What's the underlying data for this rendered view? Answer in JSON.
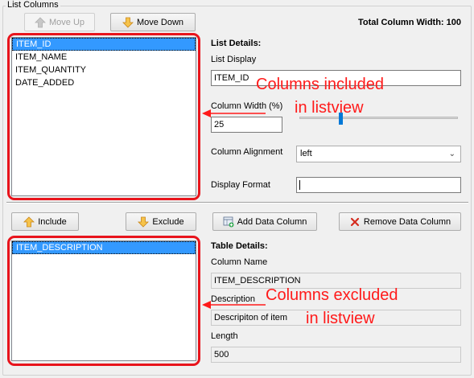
{
  "group": {
    "title": "List Columns"
  },
  "buttons": {
    "move_up": "Move Up",
    "move_down": "Move Down",
    "include": "Include",
    "exclude": "Exclude",
    "add_data_column": "Add Data Column",
    "remove_data_column": "Remove Data Column"
  },
  "total_width": "Total Column Width: 100",
  "included_list": [
    "ITEM_ID",
    "ITEM_NAME",
    "ITEM_QUANTITY",
    "DATE_ADDED"
  ],
  "excluded_list": [
    "ITEM_DESCRIPTION"
  ],
  "list_details": {
    "heading": "List Details:",
    "display_label": "List Display",
    "display_value": "ITEM_ID",
    "width_label": "Column Width (%)",
    "width_value": "25",
    "width_slider_level": 0.25,
    "alignment_label": "Column Alignment",
    "alignment_value": "left",
    "format_label": "Display Format",
    "format_value": ""
  },
  "table_details": {
    "heading": "Table Details:",
    "name_label": "Column Name",
    "name_value": "ITEM_DESCRIPTION",
    "description_label": "Description",
    "description_value": "Descripiton of item",
    "length_label": "Length",
    "length_value": "500"
  },
  "annotations": {
    "included_line1": "Columns included",
    "included_line2": "in listview",
    "excluded_line1": "Columns excluded",
    "excluded_line2": "in listview"
  },
  "colors": {
    "annotation": "#ff1a1a",
    "selection": "#3399ff",
    "slider": "#0078d7"
  },
  "icons": {
    "move_up": "arrow-up-icon",
    "move_down": "arrow-down-icon",
    "include": "arrow-up-icon",
    "exclude": "arrow-down-icon",
    "add_column": "add-table-icon",
    "remove_column": "red-x-icon"
  }
}
